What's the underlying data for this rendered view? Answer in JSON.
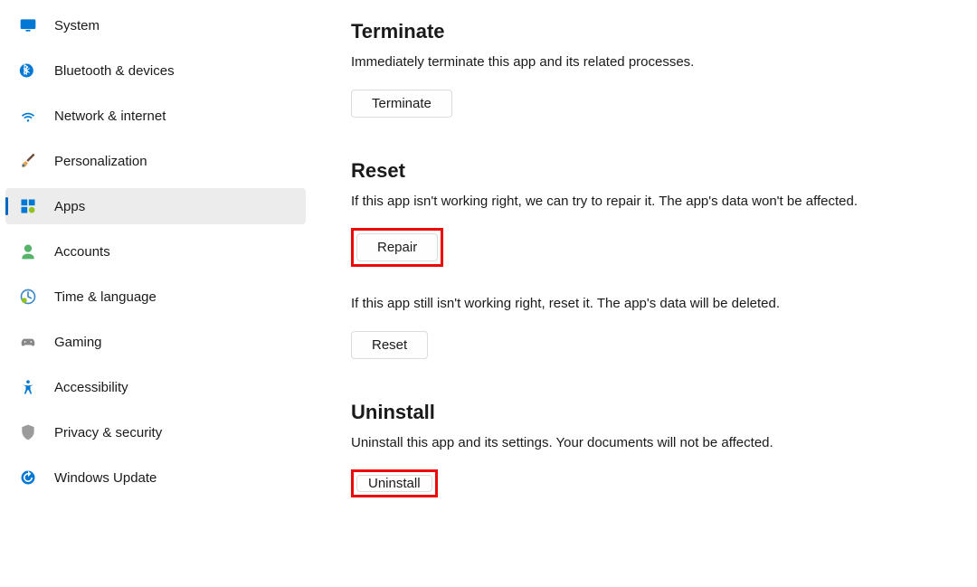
{
  "sidebar": {
    "items": [
      {
        "label": "System"
      },
      {
        "label": "Bluetooth & devices"
      },
      {
        "label": "Network & internet"
      },
      {
        "label": "Personalization"
      },
      {
        "label": "Apps"
      },
      {
        "label": "Accounts"
      },
      {
        "label": "Time & language"
      },
      {
        "label": "Gaming"
      },
      {
        "label": "Accessibility"
      },
      {
        "label": "Privacy & security"
      },
      {
        "label": "Windows Update"
      }
    ]
  },
  "sections": {
    "terminate": {
      "title": "Terminate",
      "desc": "Immediately terminate this app and its related processes.",
      "button": "Terminate"
    },
    "reset": {
      "title": "Reset",
      "desc1": "If this app isn't working right, we can try to repair it. The app's data won't be affected.",
      "button1": "Repair",
      "desc2": "If this app still isn't working right, reset it. The app's data will be deleted.",
      "button2": "Reset"
    },
    "uninstall": {
      "title": "Uninstall",
      "desc": "Uninstall this app and its settings. Your documents will not be affected.",
      "button": "Uninstall"
    }
  }
}
